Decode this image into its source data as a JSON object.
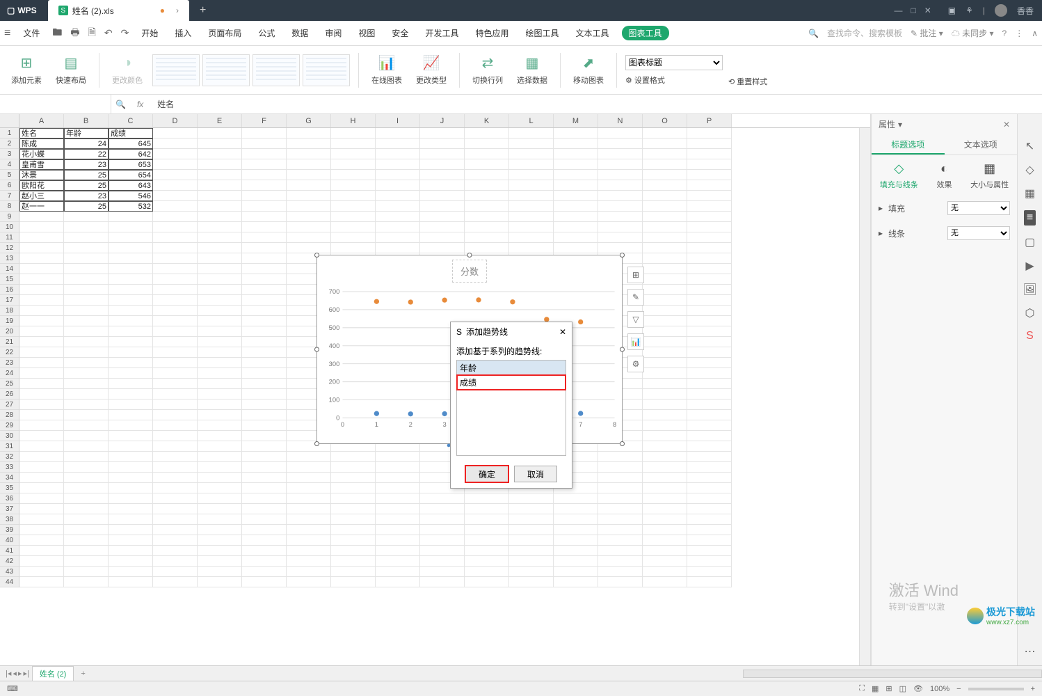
{
  "app": {
    "name": "WPS",
    "tab_file": "姓名 (2).xls",
    "user_name": "香香"
  },
  "menu": {
    "file": "文件",
    "start": "开始",
    "insert": "插入",
    "pagelayout": "页面布局",
    "formula": "公式",
    "data": "数据",
    "review": "审阅",
    "view": "视图",
    "security": "安全",
    "dev": "开发工具",
    "special": "特色应用",
    "draw": "绘图工具",
    "text": "文本工具",
    "chart": "图表工具",
    "search_placeholder": "查找命令、搜索模板",
    "annotate": "批注",
    "sync": "未同步"
  },
  "toolbar": {
    "add_element": "添加元素",
    "quick_layout": "快速布局",
    "change_color": "更改颜色",
    "online_chart": "在线图表",
    "change_type": "更改类型",
    "switch_rowcol": "切换行列",
    "select_data": "选择数据",
    "move_chart": "移动图表",
    "set_format": "设置格式",
    "reset_style": "重置样式",
    "chart_title_combo": "图表标题"
  },
  "formula_bar": {
    "fx": "fx",
    "value": "姓名"
  },
  "columns": [
    "A",
    "B",
    "C",
    "D",
    "E",
    "F",
    "G",
    "H",
    "I",
    "J",
    "K",
    "L",
    "M",
    "N",
    "O",
    "P"
  ],
  "table": {
    "headers": [
      "姓名",
      "年龄",
      "成绩"
    ],
    "rows": [
      [
        "陈成",
        "24",
        "645"
      ],
      [
        "花小蝶",
        "22",
        "642"
      ],
      [
        "皇甫雪",
        "23",
        "653"
      ],
      [
        "沐景",
        "25",
        "654"
      ],
      [
        "欧阳花",
        "25",
        "643"
      ],
      [
        "赵小三",
        "23",
        "546"
      ],
      [
        "赵一一",
        "25",
        "532"
      ]
    ]
  },
  "chart_data": {
    "type": "scatter",
    "title": "分数",
    "x": [
      1,
      2,
      3,
      4,
      5,
      6,
      7
    ],
    "xlim": [
      0,
      8
    ],
    "ylim": [
      0,
      700
    ],
    "yticks": [
      0,
      100,
      200,
      300,
      400,
      500,
      600,
      700
    ],
    "series": [
      {
        "name": "年龄",
        "color": "#4f8bc9",
        "values": [
          24,
          22,
          23,
          25,
          25,
          23,
          25
        ]
      },
      {
        "name": "成绩",
        "color": "#e88b3a",
        "values": [
          645,
          642,
          653,
          654,
          643,
          546,
          532
        ]
      }
    ]
  },
  "dialog": {
    "title": "添加趋势线",
    "label": "添加基于系列的趋势线:",
    "items": [
      "年龄",
      "成绩"
    ],
    "selected": 0,
    "highlight": 1,
    "ok": "确定",
    "cancel": "取消"
  },
  "rightpanel": {
    "header": "属性",
    "tab_title": "标题选项",
    "tab_text": "文本选项",
    "sec_fill": "填充与线条",
    "sec_effect": "效果",
    "sec_size": "大小与属性",
    "fill_label": "填充",
    "fill_value": "无",
    "line_label": "线条",
    "line_value": "无"
  },
  "sheettab": {
    "name": "姓名 (2)"
  },
  "status": {
    "zoom": "100%"
  },
  "watermark": {
    "activate": "激活 Wind",
    "hint": "转到\"设置\"以激",
    "site": "极光下载站",
    "url": "www.xz7.com"
  }
}
